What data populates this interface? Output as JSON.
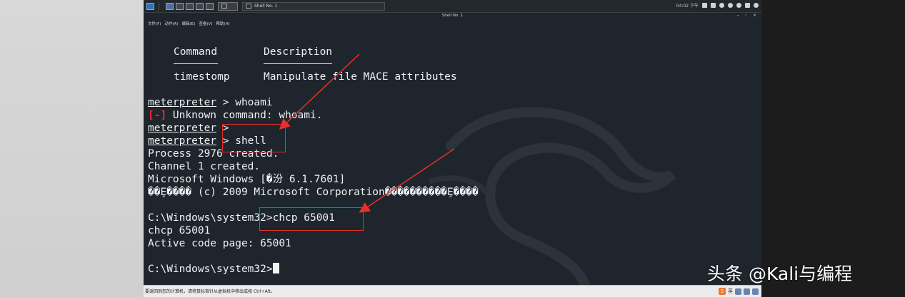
{
  "taskbar": {
    "window_label": "Shell No. 1",
    "clock": "04:02 下午"
  },
  "titlebar": {
    "title": "Shell No. 1",
    "controls": "– ◦ ×"
  },
  "menu": [
    {
      "label": "文件(F)"
    },
    {
      "label": "动作(A)"
    },
    {
      "label": "编辑(E)"
    },
    {
      "label": "查看(V)"
    },
    {
      "label": "帮助(H)"
    }
  ],
  "terminal": {
    "header_command": "Command",
    "header_description": "Description",
    "row_command": "timestomp",
    "row_description": "Manipulate file MACE attributes",
    "prompt": "meterpreter",
    "cmd_whoami": " > whoami",
    "err_tag": "[-]",
    "err_text": " Unknown command: whoami.",
    "cmd_empty": " >",
    "cmd_shell": " > shell",
    "process_created": "Process 2976 created.",
    "channel_created": "Channel 1 created.",
    "ms_version": "Microsoft Windows [�汾 6.1.7601]",
    "copyright": "��Ȩ���� (c) 2009 Microsoft Corporation����������Ȩ����",
    "cmd_chcp": "C:\\Windows\\system32>chcp 65001",
    "echo_chcp": "chcp 65001",
    "code_page": "Active code page: 65001",
    "final_prompt": "C:\\Windows\\system32>"
  },
  "statusbar": {
    "message": "要返回到您的计算机，请将鼠标指针从虚拟机中移出或按 Ctrl+Alt。",
    "ime_label": "英"
  },
  "watermark": "头条 @Kali与编程",
  "colors": {
    "annotation_red": "#e8302a",
    "error_red": "#e03030",
    "terminal_bg": "#1f252c"
  }
}
